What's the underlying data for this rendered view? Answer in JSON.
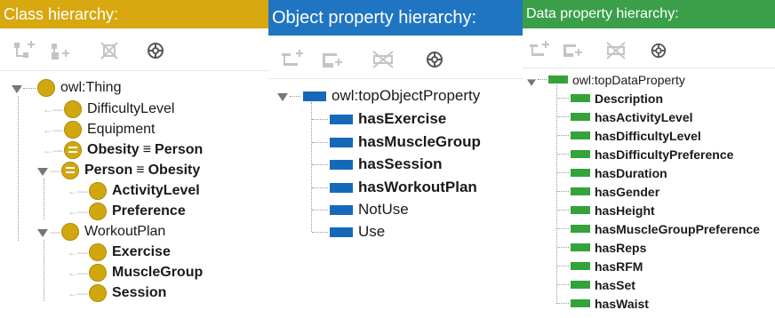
{
  "colors": {
    "class_header": "#d7a80f",
    "object_header": "#1f75c2",
    "data_header": "#3a9f48",
    "class_icon": "#d1a70f",
    "object_icon": "#1669b8",
    "data_icon": "#33a33a"
  },
  "class_panel": {
    "title": "Class hierarchy:",
    "toolbar": [
      "add-subclass-icon",
      "add-sibling-class-icon",
      "delete-class-icon",
      "options-icon"
    ],
    "tree": {
      "root": "owl:Thing",
      "items": [
        {
          "label": "DifficultyLevel",
          "equivalent": false
        },
        {
          "label": "Equipment",
          "equivalent": false
        },
        {
          "label": "Obesity",
          "equivalent": true,
          "equiv_symbol": "≡",
          "equiv_to": "Person"
        },
        {
          "label": "Person",
          "equivalent": true,
          "equiv_symbol": "≡",
          "equiv_to": "Obesity",
          "children": [
            "ActivityLevel",
            "Preference"
          ]
        },
        {
          "label": "WorkoutPlan",
          "equivalent": false,
          "children": [
            "Exercise",
            "MuscleGroup",
            "Session"
          ]
        }
      ]
    }
  },
  "object_panel": {
    "title": "Object property hierarchy:",
    "toolbar": [
      "add-subproperty-icon",
      "add-sibling-property-icon",
      "delete-property-icon",
      "options-icon"
    ],
    "tree": {
      "root": "owl:topObjectProperty",
      "items": [
        {
          "label": "hasExercise",
          "bold": true
        },
        {
          "label": "hasMuscleGroup",
          "bold": true
        },
        {
          "label": "hasSession",
          "bold": true
        },
        {
          "label": "hasWorkoutPlan",
          "bold": true
        },
        {
          "label": "NotUse",
          "bold": false
        },
        {
          "label": "Use",
          "bold": false
        }
      ]
    }
  },
  "data_panel": {
    "title": "Data property hierarchy:",
    "toolbar": [
      "add-subproperty-icon",
      "add-sibling-property-icon",
      "delete-property-icon",
      "options-icon"
    ],
    "tree": {
      "root": "owl:topDataProperty",
      "items": [
        "Description",
        "hasActivityLevel",
        "hasDifficultyLevel",
        "hasDifficultyPreference",
        "hasDuration",
        "hasGender",
        "hasHeight",
        "hasMuscleGroupPreference",
        "hasReps",
        "hasRFM",
        "hasSet",
        "hasWaist"
      ]
    }
  }
}
